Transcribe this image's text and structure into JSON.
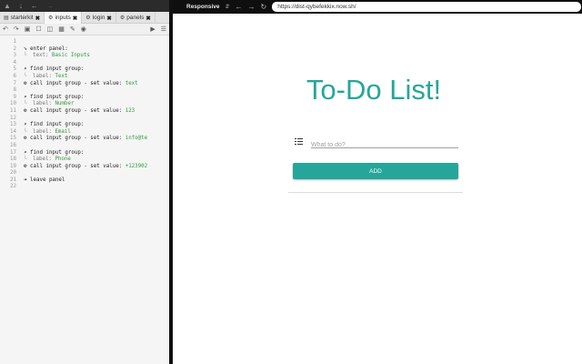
{
  "left_topbar": {
    "icons": [
      "pin-icon",
      "download-icon",
      "back-icon",
      "forward-icon"
    ]
  },
  "tabs": [
    {
      "label": "starterkit",
      "icon": "file-icon"
    },
    {
      "label": "inputs",
      "icon": "gear-icon"
    },
    {
      "label": "login",
      "icon": "gear-icon"
    },
    {
      "label": "panels",
      "icon": "gear-icon"
    }
  ],
  "code_lines": [
    {
      "num": "1",
      "icon": "",
      "text": "",
      "arg": "",
      "val": "",
      "indent": false
    },
    {
      "num": "2",
      "icon": "➘",
      "text": "enter panel:",
      "arg": "",
      "val": "",
      "indent": false
    },
    {
      "num": "3",
      "icon": "",
      "text": "",
      "arg": "text: ",
      "val": "Basic Inputs",
      "indent": true
    },
    {
      "num": "4",
      "icon": "",
      "text": "",
      "arg": "",
      "val": "",
      "indent": false
    },
    {
      "num": "5",
      "icon": "⌕",
      "text": "find input group:",
      "arg": "",
      "val": "",
      "indent": false
    },
    {
      "num": "6",
      "icon": "",
      "text": "",
      "arg": "label: ",
      "val": "Text",
      "indent": true
    },
    {
      "num": "7",
      "icon": "⚙",
      "text": "call input group - set value: ",
      "arg": "",
      "val": "text",
      "indent": false
    },
    {
      "num": "8",
      "icon": "",
      "text": "",
      "arg": "",
      "val": "",
      "indent": false
    },
    {
      "num": "9",
      "icon": "⌕",
      "text": "find input group:",
      "arg": "",
      "val": "",
      "indent": false
    },
    {
      "num": "10",
      "icon": "",
      "text": "",
      "arg": "label: ",
      "val": "Number",
      "indent": true
    },
    {
      "num": "11",
      "icon": "⚙",
      "text": "call input group - set value: ",
      "arg": "",
      "val": "123",
      "indent": false
    },
    {
      "num": "12",
      "icon": "",
      "text": "",
      "arg": "",
      "val": "",
      "indent": false
    },
    {
      "num": "13",
      "icon": "⌕",
      "text": "find input group:",
      "arg": "",
      "val": "",
      "indent": false
    },
    {
      "num": "14",
      "icon": "",
      "text": "",
      "arg": "label: ",
      "val": "Email",
      "indent": true
    },
    {
      "num": "15",
      "icon": "⚙",
      "text": "call input group - set value: ",
      "arg": "",
      "val": "info@te",
      "indent": false
    },
    {
      "num": "16",
      "icon": "",
      "text": "",
      "arg": "",
      "val": "",
      "indent": false
    },
    {
      "num": "17",
      "icon": "⌕",
      "text": "find input group:",
      "arg": "",
      "val": "",
      "indent": false
    },
    {
      "num": "18",
      "icon": "",
      "text": "",
      "arg": "label: ",
      "val": "Phone",
      "indent": true
    },
    {
      "num": "19",
      "icon": "⚙",
      "text": "call input group - set value: ",
      "arg": "",
      "val": "+123902",
      "indent": false
    },
    {
      "num": "20",
      "icon": "",
      "text": "",
      "arg": "",
      "val": "",
      "indent": false
    },
    {
      "num": "21",
      "icon": "➜",
      "text": "leave panel",
      "arg": "",
      "val": "",
      "indent": false
    },
    {
      "num": "22",
      "icon": "",
      "text": "",
      "arg": "",
      "val": "",
      "indent": false
    }
  ],
  "browser": {
    "mode_label": "Responsive",
    "url": "https://dist-qybefekkix.now.sh/"
  },
  "app": {
    "title": "To-Do List!",
    "input_placeholder": "What to do?",
    "input_value": "",
    "add_label": "ADD",
    "accent_color": "#26a69a"
  }
}
